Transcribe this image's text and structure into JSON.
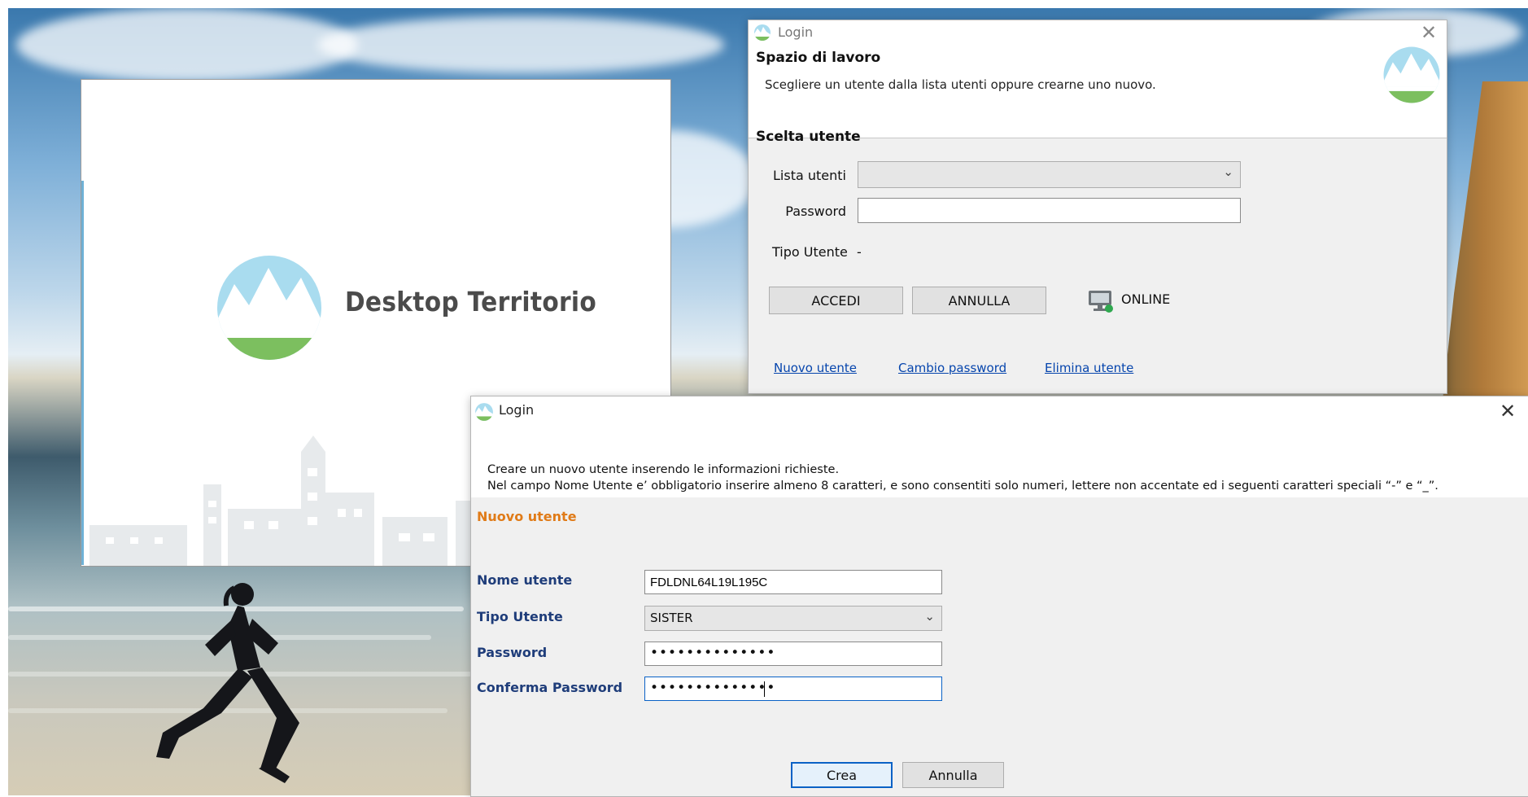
{
  "splash": {
    "title": "Desktop Territorio"
  },
  "login_main": {
    "window_title": "Login",
    "header_title": "Spazio di lavoro",
    "header_desc": "Scegliere un utente dalla lista utenti oppure crearne uno nuovo.",
    "section_title": "Scelta utente",
    "lista_utenti_label": "Lista utenti",
    "lista_utenti_value": "",
    "password_label": "Password",
    "password_value": "",
    "tipo_utente_label": "Tipo Utente",
    "tipo_utente_value": "-",
    "accedi_label": "ACCEDI",
    "annulla_label": "ANNULLA",
    "status_label": "ONLINE",
    "links": {
      "nuovo_utente": "Nuovo utente",
      "cambio_password": "Cambio password",
      "elimina_utente": "Elimina utente"
    }
  },
  "new_user": {
    "window_title": "Login",
    "info_line1": "Creare un nuovo utente inserendo le informazioni richieste.",
    "info_line2": "Nel campo Nome Utente e’ obbligatorio inserire almeno 8 caratteri, e sono consentiti solo numeri, lettere non accentate ed i seguenti caratteri speciali “-” e “_”.",
    "section_title": "Nuovo utente",
    "nome_utente_label": "Nome utente",
    "nome_utente_value": "FDLDNL64L19L195C",
    "tipo_utente_label": "Tipo Utente",
    "tipo_utente_value": "SISTER",
    "password_label": "Password",
    "password_value": "••••••••••••••",
    "conferma_label": "Conferma Password",
    "conferma_value": "••••••••••••••",
    "crea_label": "Crea",
    "annulla_label": "Annulla"
  },
  "colors": {
    "logo_sky": "#a9dcef",
    "logo_grass": "#7cbf5f",
    "section_orange": "#e07b18",
    "field_label_blue": "#1f3d7a",
    "online_dot": "#2fa84f"
  }
}
